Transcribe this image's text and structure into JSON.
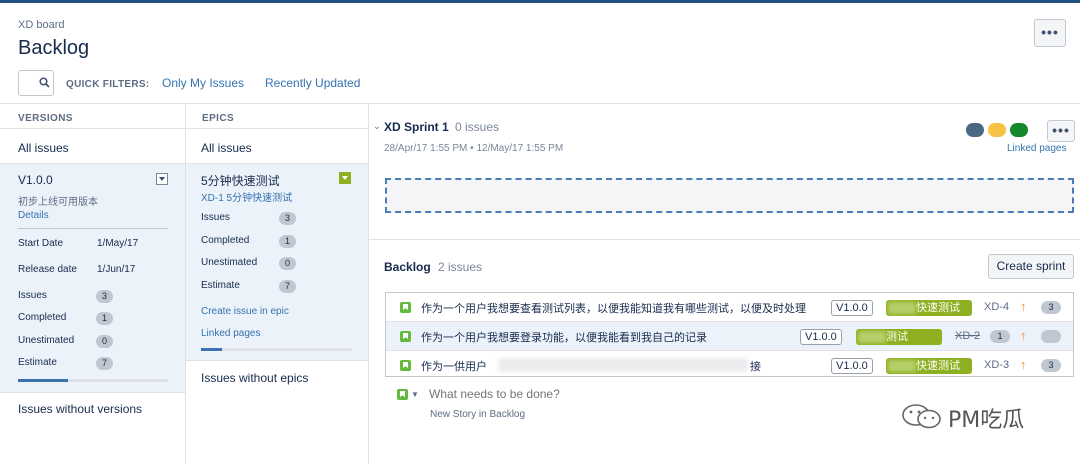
{
  "header": {
    "breadcrumb": "XD board",
    "title": "Backlog",
    "more_label": "•••",
    "quick_filters_label": "QUICK FILTERS:",
    "quick_filters": [
      "Only My Issues",
      "Recently Updated"
    ]
  },
  "versions": {
    "label": "VERSIONS",
    "all_issues": "All issues",
    "card": {
      "name": "V1.0.0",
      "description": "初步上线可用版本",
      "details_link": "Details",
      "start_label": "Start Date",
      "start_value": "1/May/17",
      "release_label": "Release date",
      "release_value": "1/Jun/17",
      "stats": [
        {
          "label": "Issues",
          "value": "3"
        },
        {
          "label": "Completed",
          "value": "1"
        },
        {
          "label": "Unestimated",
          "value": "0"
        },
        {
          "label": "Estimate",
          "value": "7"
        }
      ],
      "progress": 0.33
    },
    "without": "Issues without versions"
  },
  "epics": {
    "label": "EPICS",
    "all_issues": "All issues",
    "card": {
      "name": "5分钟快速测试",
      "key_line": "XD-1 5分钟快速测试",
      "stats": [
        {
          "label": "Issues",
          "value": "3"
        },
        {
          "label": "Completed",
          "value": "1"
        },
        {
          "label": "Unestimated",
          "value": "0"
        },
        {
          "label": "Estimate",
          "value": "7"
        }
      ],
      "create_link": "Create issue in epic",
      "linked_link": "Linked pages",
      "progress": 0.14
    },
    "without": "Issues without epics"
  },
  "sprint": {
    "name": "XD Sprint 1",
    "count": "0 issues",
    "dates": "28/Apr/17 1:55 PM • 12/May/17 1:55 PM",
    "status_colors": [
      "#4a6785",
      "#f6c342",
      "#14892c"
    ],
    "more_label": "•••",
    "linked_pages": "Linked pages"
  },
  "backlog": {
    "title": "Backlog",
    "count": "2 issues",
    "create_sprint": "Create sprint",
    "issues": [
      {
        "summary": "作为一个用户我想要查看测试列表，以便我能知道我有哪些测试，以便及时处理",
        "version": "V1.0.0",
        "epic": "快速测试",
        "key": "XD-4",
        "estimate": "3",
        "done": false
      },
      {
        "summary": "作为一个用户我想要登录功能，以便我能看到我自己的记录",
        "version": "V1.0.0",
        "epic": "测试",
        "key": "XD-2",
        "estimate": "1",
        "done": true
      },
      {
        "summary": "作为一供用户",
        "summary_tail": "接",
        "version": "V1.0.0",
        "epic": "快速测试",
        "key": "XD-3",
        "estimate": "3",
        "done": false
      }
    ],
    "create_placeholder": "What needs to be done?",
    "create_hint": "New Story in Backlog"
  },
  "watermark": {
    "text": "PM吃瓜"
  }
}
